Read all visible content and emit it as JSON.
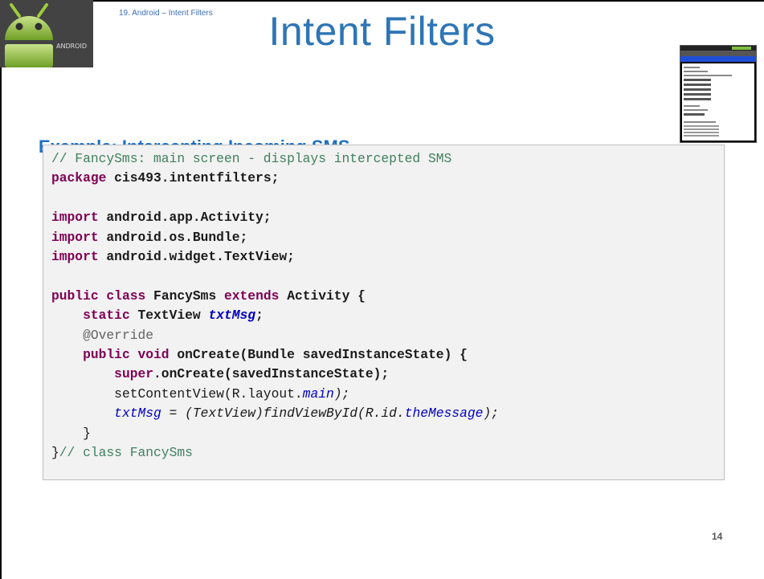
{
  "header": {
    "breadcrumb": "19. Android – Intent Filters",
    "title": "Intent Filters",
    "logo_text": "ANDROID"
  },
  "subtitle": "Example: Intercepting Incoming SMS",
  "code": {
    "line1_comment": "// FancySms: main screen - displays intercepted SMS",
    "line2_kw": "package",
    "line2_rest": " cis493.intentfilters;",
    "line4_kw": "import",
    "line4_rest": " android.app.Activity;",
    "line5_kw": "import",
    "line5_rest": " android.os.Bundle;",
    "line6_kw": "import",
    "line6_rest": " android.widget.TextView;",
    "line8_kw1": "public",
    "line8_kw2": "class",
    "line8_name": "FancySms",
    "line8_kw3": "extends",
    "line8_rest": "Activity {",
    "line9_kw": "static",
    "line9_type": "TextView",
    "line9_field": "txtMsg",
    "line9_semi": ";",
    "line10_annotation": "@Override",
    "line11_kw1": "public",
    "line11_kw2": "void",
    "line11_rest": "onCreate(Bundle savedInstanceState) {",
    "line12_kw": "super",
    "line12_rest": ".onCreate(savedInstanceState);",
    "line13_a": "setContentView(R.layout.",
    "line13_field": "main",
    "line13_b": ");",
    "line14_field1": "txtMsg",
    "line14_a": " = (TextView)findViewById(R.id.",
    "line14_field2": "theMessage",
    "line14_b": ");",
    "line15_brace": "}",
    "line16_brace": "}",
    "line16_comment": "// class FancySms"
  },
  "page_number": "14",
  "colors": {
    "title": "#2e75b6",
    "subtitle": "#1f6fbf",
    "keyword": "#7f0055",
    "comment": "#3f7f5f",
    "field": "#0000c0",
    "code_background": "#f2f2f2"
  },
  "icons": [
    "android-logo-icon",
    "phone-screenshot-thumbnail"
  ]
}
